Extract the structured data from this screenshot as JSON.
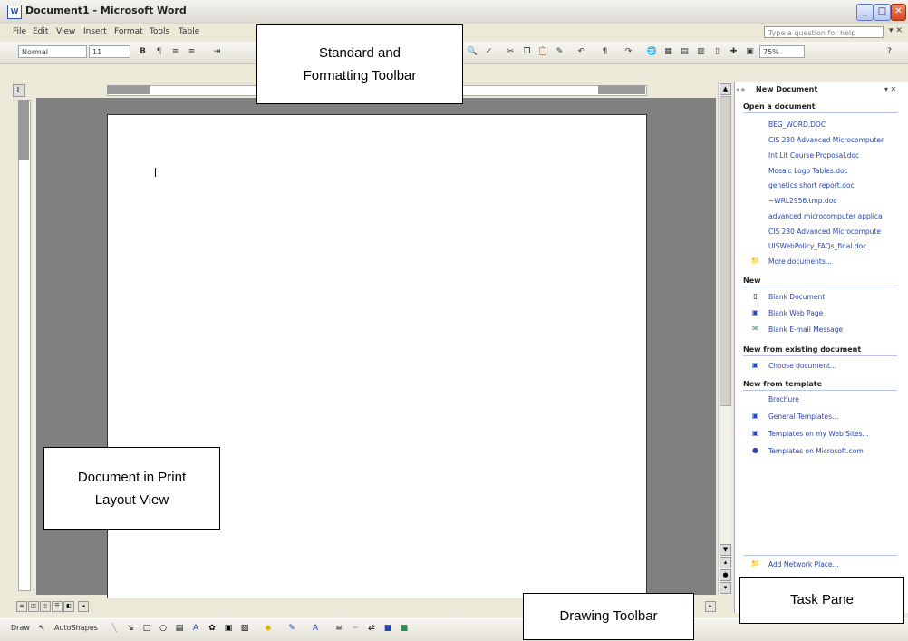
{
  "window": {
    "title": "Document1 - Microsoft Word",
    "icon": "W"
  },
  "menu": [
    "File",
    "Edit",
    "View",
    "Insert",
    "Format",
    "Tools",
    "Table"
  ],
  "ask_placeholder": "Type a question for help",
  "toolbar": {
    "style": "Normal",
    "size": "11",
    "zoom": "75%"
  },
  "task_pane": {
    "title": "New Document",
    "open_heading": "Open a document",
    "recent_files": [
      "BEG_WORD.DOC",
      "CIS 230 Advanced Microcomputer",
      "Int Lit Course Proposal.doc",
      "Mosaic Logo Tables.doc",
      "genetics short report.doc",
      "~WRL2956.tmp.doc",
      "advanced microcomputer applica",
      "CIS 230 Advanced Microcompute",
      "UISWebPolicy_FAQs_final.doc"
    ],
    "more_documents": "More documents...",
    "new_heading": "New",
    "new_items": [
      "Blank Document",
      "Blank Web Page",
      "Blank E-mail Message"
    ],
    "existing_heading": "New from existing document",
    "choose_document": "Choose document...",
    "template_heading": "New from template",
    "template_items": [
      "Brochure",
      "General Templates...",
      "Templates on my Web Sites...",
      "Templates on Microsoft.com"
    ],
    "add_network_place": "Add Network Place..."
  },
  "drawbar": {
    "draw": "Draw",
    "autoshapes": "AutoShapes"
  },
  "callouts": {
    "toolbar_line1": "Standard and",
    "toolbar_line2": "Formatting Toolbar",
    "document_line1": "Document in Print",
    "document_line2": "Layout View",
    "drawing": "Drawing Toolbar",
    "taskpane": "Task Pane"
  }
}
